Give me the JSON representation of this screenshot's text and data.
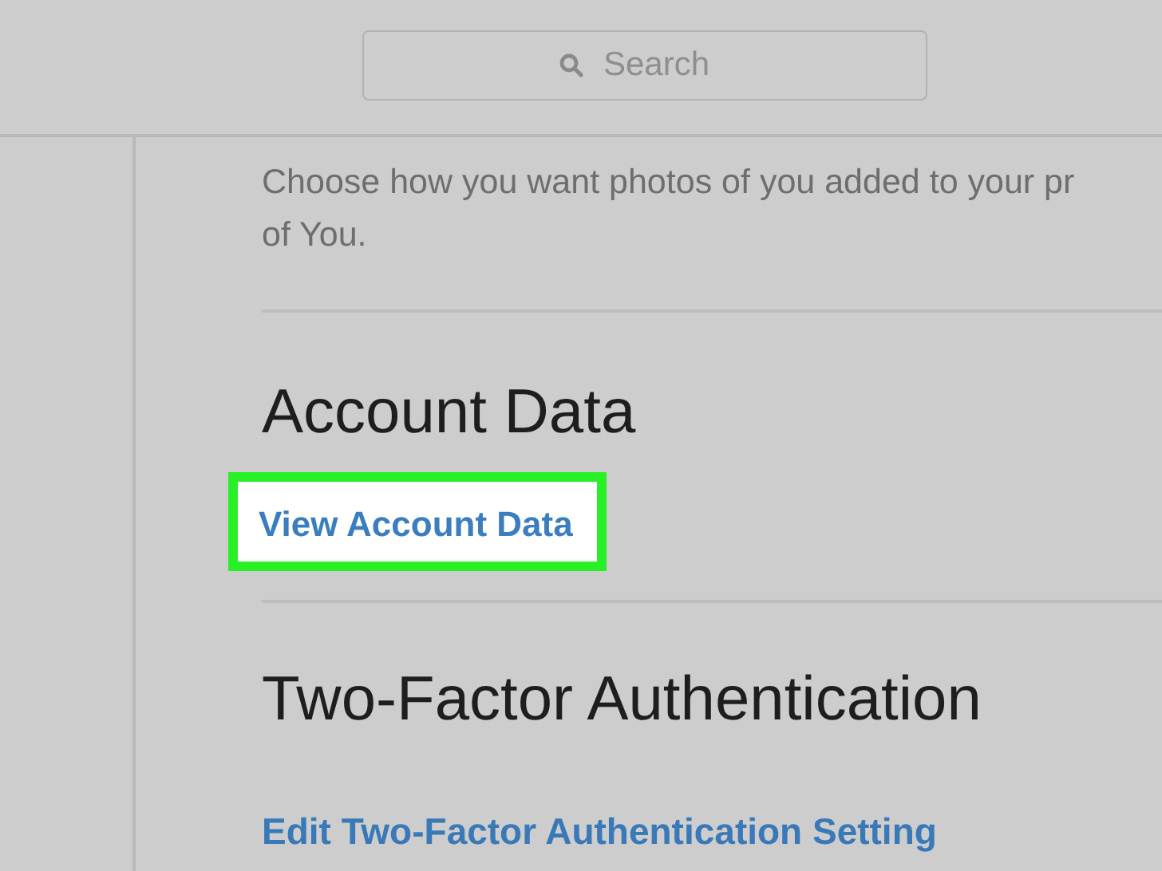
{
  "search": {
    "placeholder": "Search"
  },
  "photos_of_you": {
    "lines": [
      "Choose how you want photos of you added to your pr",
      "of You."
    ]
  },
  "account_data": {
    "heading": "Account Data",
    "link": "View Account Data",
    "highlighted": true
  },
  "two_factor": {
    "heading": "Two-Factor Authentication",
    "link": "Edit Two-Factor Authentication Setting"
  }
}
